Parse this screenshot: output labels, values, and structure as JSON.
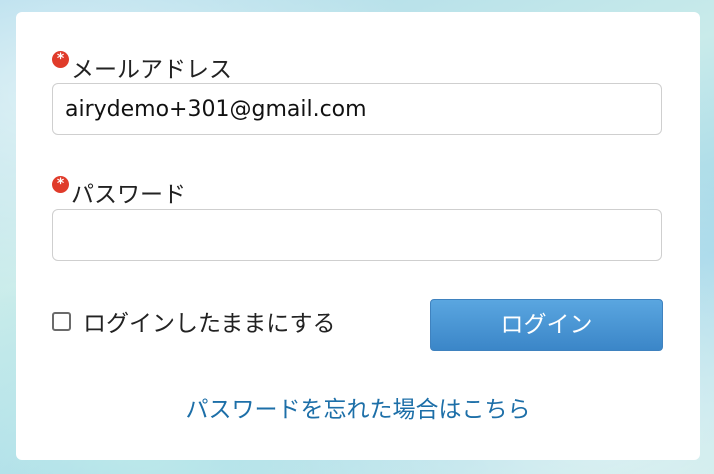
{
  "form": {
    "email": {
      "label": "メールアドレス",
      "value": "airydemo+301@gmail.com",
      "required_mark": "*"
    },
    "password": {
      "label": "パスワード",
      "value": "",
      "required_mark": "*"
    },
    "remember_me": {
      "label": "ログインしたままにする",
      "checked": false
    },
    "login_button": "ログイン",
    "forgot_password_link": "パスワードを忘れた場合はこちら"
  },
  "colors": {
    "required": "#e03b2a",
    "button": "#4a97d6",
    "link": "#1d6fa8"
  }
}
